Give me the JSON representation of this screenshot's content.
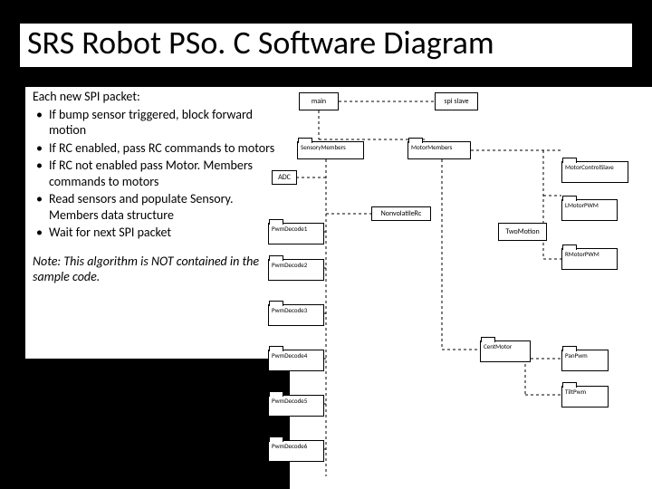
{
  "title": "SRS Robot PSo. C Software Diagram",
  "intro": "Each new SPI packet:",
  "bullets": [
    "If bump sensor triggered, block forward motion",
    "If RC enabled, pass RC commands to motors",
    "If RC not enabled pass Motor. Members commands to motors",
    "Read sensors and populate Sensory. Members data structure",
    "Wait for next SPI packet"
  ],
  "note": "Note: This algorithm is NOT contained in the sample code.",
  "diagram": {
    "top_left": "main",
    "top_right": "spi slave",
    "sensory": "SensoryMembers",
    "motor": "MotorMembers",
    "adc": "ADC",
    "nonvolatile": "NonvolatileRc",
    "pwm_decoders": [
      "PwmDecode1",
      "PwmDecode2",
      "PwmDecode3",
      "PwmDecode4",
      "PwmDecode5",
      "PwmDecode6"
    ],
    "centmotor": "CentMotor",
    "right_boxes": [
      "MotorControlSlave",
      "LMotorPWM",
      "RMotorPWM",
      "PanPwm",
      "TiltPwm"
    ],
    "center_right": "TwoMotion"
  }
}
